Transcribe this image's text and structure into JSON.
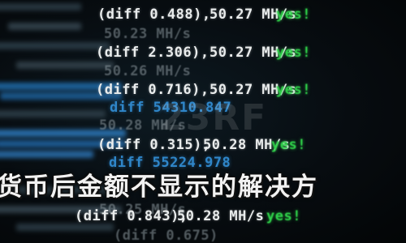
{
  "caption": "货币后金额不显示的解决方",
  "watermark": "23RF",
  "colors": {
    "background": "#05080b",
    "green": "#2fd24a",
    "blue": "#2f86c9",
    "white": "#e9ecec"
  },
  "log_lines": [
    {
      "diff": "(diff 0.488),",
      "rate": "50.27 MH/s",
      "status": "yes!"
    },
    {
      "partial": "50.23 MH/s"
    },
    {
      "diff": "(diff 2.306),",
      "rate": "50.27 MH/s",
      "status": "yes!"
    },
    {
      "partial": "50.26 MH/s"
    },
    {
      "diff": "(diff 0.716),",
      "rate": "50.27 MH/s",
      "status": "yes!"
    },
    {
      "partial": "diff 54310.847"
    },
    {
      "partial": "50.28 MH/s"
    },
    {
      "diff": "(diff 0.315),",
      "rate": "50.28 MH/s",
      "status": "yes!"
    },
    {
      "partial": "diff 55224.978"
    },
    {
      "partial": "50.25 MH/s"
    },
    {
      "diff": "(diff 0.843),",
      "rate": "50.28 MH/s",
      "status": "yes!"
    },
    {
      "partial": "(diff 0.675)"
    }
  ]
}
